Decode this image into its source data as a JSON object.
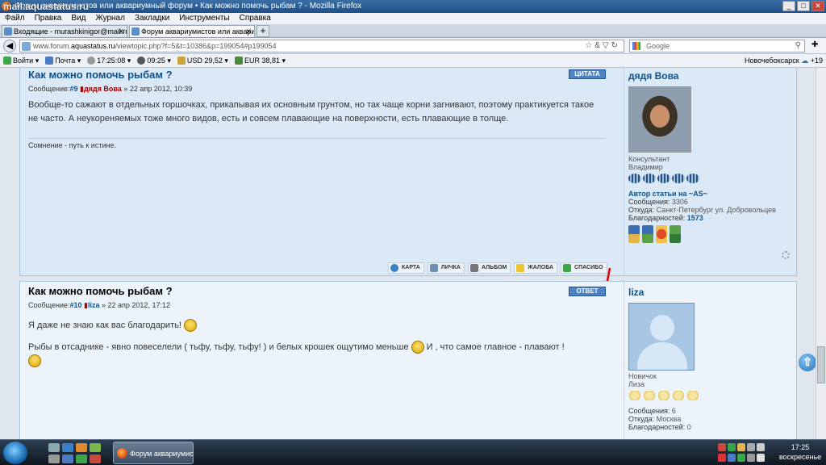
{
  "window": {
    "title": "Форум аквариумистов или аквариумный форум • Как можно помочь рыбам ? - Mozilla Firefox",
    "watermark": "mail.aquastatus.ru"
  },
  "menu": [
    "Файл",
    "Правка",
    "Вид",
    "Журнал",
    "Закладки",
    "Инструменты",
    "Справка"
  ],
  "tabs": [
    {
      "label": "Входящие - murashkinigor@mail.ru - По..."
    },
    {
      "label": "Форум аквариумистов или аквариумны..."
    }
  ],
  "nav": {
    "url_prefix": "www.forum.",
    "url_domain": "aquastatus.ru",
    "url_path": "/viewtopic.php?f=5&t=10386&p=199054#p199054",
    "search_placeholder": "Google"
  },
  "toolbar": {
    "login": "Войти",
    "mail": "Почта",
    "time1": "17:25:08",
    "time2": "09:25",
    "usd": "USD 29,52",
    "eur": "EUR 38,81",
    "city": "Новочебоксарск",
    "temp": "+19"
  },
  "post1": {
    "title": "Как можно помочь рыбам ?",
    "meta_prefix": "Сообщение:",
    "num": "#9",
    "author": "дядя Вова",
    "date": "» 22 апр 2012, 10:39",
    "quote_btn": "ЦИТАТА",
    "text": "Вообще-то сажают в отдельных горшочках, прикапывая их основным грунтом, но так чаще корни загнивают, поэтому практикуется такое не часто. А неукореняемых тоже много видов, есть и совсем плавающие на поверхности, есть плавающие в толще.",
    "signature": "Сомнение - путь к истине.",
    "actions": {
      "map": "КАРТА",
      "pm": "ЛИЧКА",
      "album": "АЛЬБОМ",
      "report": "ЖАЛОБА",
      "thanks": "СПАСИБО"
    },
    "profile": {
      "name": "дядя Вова",
      "rank": "Консультант",
      "realname": "Владимир",
      "article": "Автор статьи на ~AS~",
      "posts_label": "Сообщения:",
      "posts": "3306",
      "from_label": "Откуда:",
      "from": "Санкт-Петербург ул. Добровольцев",
      "thanks_label": "Благодарностей:",
      "thanks": "1573"
    }
  },
  "post2": {
    "title": "Как можно помочь рыбам ?",
    "meta_prefix": "Сообщение:",
    "num": "#10",
    "author": "liza",
    "date": "» 22 апр 2012, 17:12",
    "reply_btn": "ОТВЕТ",
    "text1": "Я даже не знаю как вас благодарить!",
    "text2a": "Рыбы в отсаднике - явно повеселели ( тьфу, тьфу, тьфу! ) и белых крошек ощутимо меньше",
    "text2b": "И , что самое главное - плавают !",
    "profile": {
      "name": "liza",
      "rank": "Новичок",
      "realname": "Лиза",
      "posts_label": "Сообщения:",
      "posts": "6",
      "from_label": "Откуда:",
      "from": "Москва",
      "thanks_label": "Благодарностей:",
      "thanks": "0"
    }
  },
  "taskbar": {
    "task": "Форум аквариумист...",
    "time": "17:25",
    "day": "воскресенье"
  },
  "colors": {
    "link": "#105289",
    "author": "#aa0000",
    "quote_btn": "#4d82c3",
    "arrow": "#e00000"
  }
}
